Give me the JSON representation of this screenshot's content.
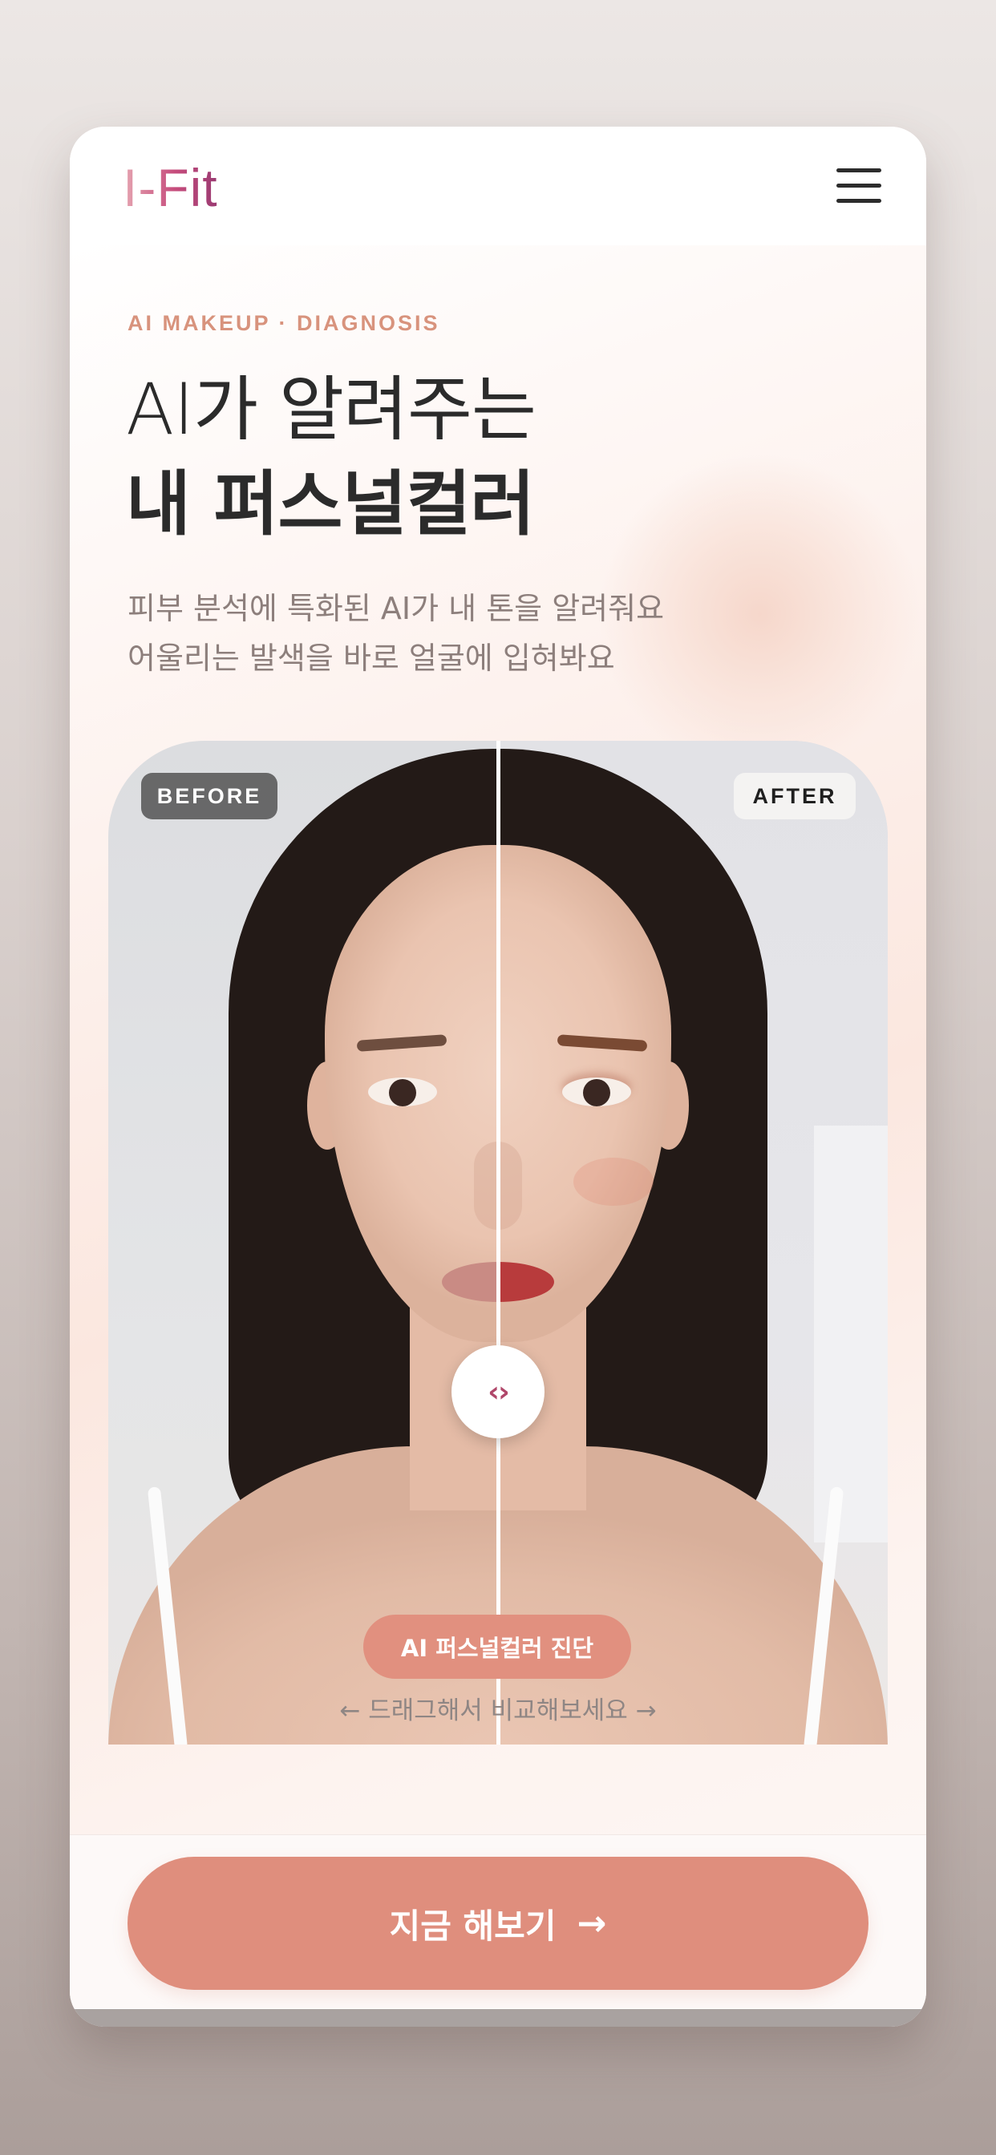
{
  "app": {
    "logo": "I-Fit",
    "menu_icon": "hamburger-menu-icon"
  },
  "hero": {
    "eyebrow": "AI MAKEUP · DIAGNOSIS",
    "title_line1": "AI가 알려주는",
    "title_line2": "내 퍼스널컬러",
    "description_line1": "피부 분석에 특화된 AI가 내 톤을 알려줘요",
    "description_line2": "어울리는 발색을 바로 얼굴에 입혀봐요"
  },
  "compare": {
    "before_label": "BEFORE",
    "after_label": "AFTER",
    "handle_icon": "‹›",
    "handle_icon_name": "chevron-left-right-icon",
    "split_fraction": 0.5
  },
  "diagnosis_pill": "AI 퍼스널컬러 진단",
  "drag_hint": "← 드래그해서 비교해보세요 →",
  "cta": {
    "label": "지금 해보기",
    "arrow": "→"
  },
  "colors": {
    "accent": "#df8e7d",
    "logo_gradient_start": "#e6a6b2",
    "logo_gradient_end": "#9a3a72",
    "eyebrow": "#d8937d",
    "heading": "#2b2b2b",
    "body_text": "#8d7f7c"
  }
}
